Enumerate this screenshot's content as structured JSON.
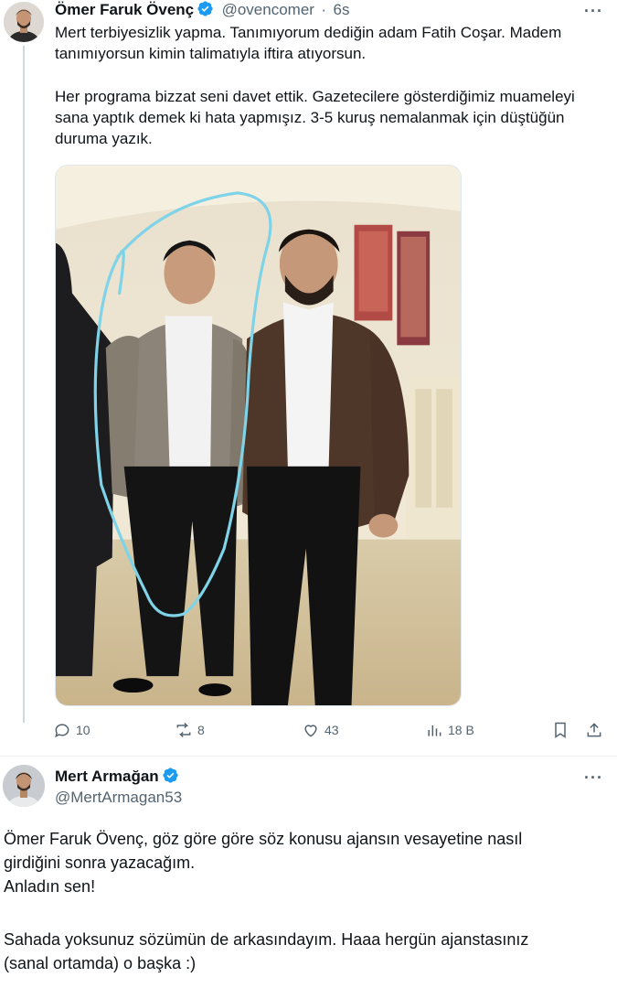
{
  "tweet1": {
    "author_name": "Ömer Faruk Övenç",
    "author_handle": "@ovencomer",
    "separator": "·",
    "time": "6s",
    "more_label": "···",
    "paragraph1": "Mert terbiyesizlik yapma. Tanımıyorum dediğin adam Fatih Coşar. Madem\ntanımıyorsun kimin talimatıyla iftira atıyorsun.",
    "paragraph2": "Her programa bizzat seni davet ettik. Gazetecilere gösterdiğimiz muameleyi\nsana yaptık demek ki hata yapmışız. 3-5 kuruş nemalanmak için düştüğün\nduruma yazık.",
    "stats": {
      "replies": "10",
      "reposts": "8",
      "likes": "43",
      "views": "18 B"
    }
  },
  "tweet2": {
    "author_name": "Mert Armağan",
    "author_handle": "@MertArmagan53",
    "more_label": "···",
    "paragraph1": "Ömer Faruk Övenç, göz göre göre söz konusu ajansın vesayetine nasıl\ngirdiğini sonra yazacağım.\nAnladın sen!",
    "paragraph2": "Sahada yoksunuz sözümün de arkasındayım. Haaa hergün ajanstasınız\n(sanal ortamda) o başka :)"
  },
  "colors": {
    "verified_blue": "#1d9bf0",
    "secondary_text": "#536471",
    "primary_text": "#0f1419",
    "annotation": "#7fd3e8"
  },
  "icons": [
    "verified-badge-icon",
    "more-icon",
    "reply-icon",
    "repost-icon",
    "like-icon",
    "views-icon",
    "bookmark-icon",
    "share-icon"
  ]
}
